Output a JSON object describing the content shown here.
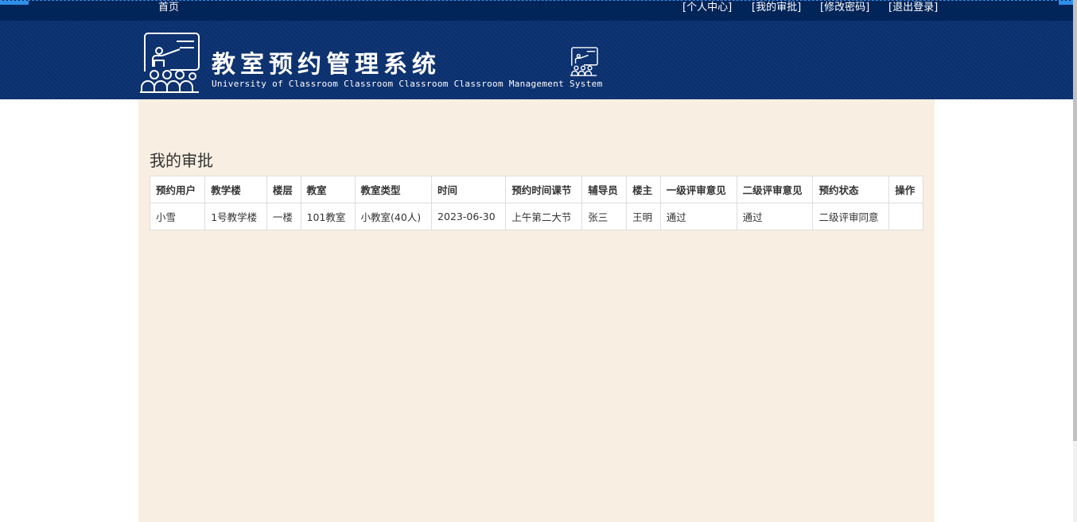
{
  "nav": {
    "home": "首页",
    "profile": "[个人中心]",
    "approval": "[我的审批]",
    "password": "[修改密码]",
    "logout": "[退出登录]"
  },
  "header": {
    "title": "教室预约管理系统",
    "subtitle": "University of Classroom Classroom Classroom Classroom Management System"
  },
  "main": {
    "page_title": "我的审批",
    "table": {
      "columns": [
        "预约用户",
        "教学楼",
        "楼层",
        "教室",
        "教室类型",
        "时间",
        "预约时间课节",
        "辅导员",
        "楼主",
        "一级评审意见",
        "二级评审意见",
        "预约状态",
        "操作"
      ],
      "rows": [
        [
          "小雪",
          "1号教学楼",
          "一楼",
          "101教室",
          "小教室(40人)",
          "2023-06-30",
          "上午第二大节",
          "张三",
          "王明",
          "通过",
          "通过",
          "二级评审同意",
          ""
        ]
      ]
    }
  },
  "colors": {
    "nav_bg": "#012459",
    "banner_bg": "#0a2f6e",
    "content_bg": "#f8efe2",
    "accent": "#2f8fe8"
  },
  "icons": {
    "logo": "classroom-teacher-icon",
    "small": "classroom-teacher-icon"
  }
}
